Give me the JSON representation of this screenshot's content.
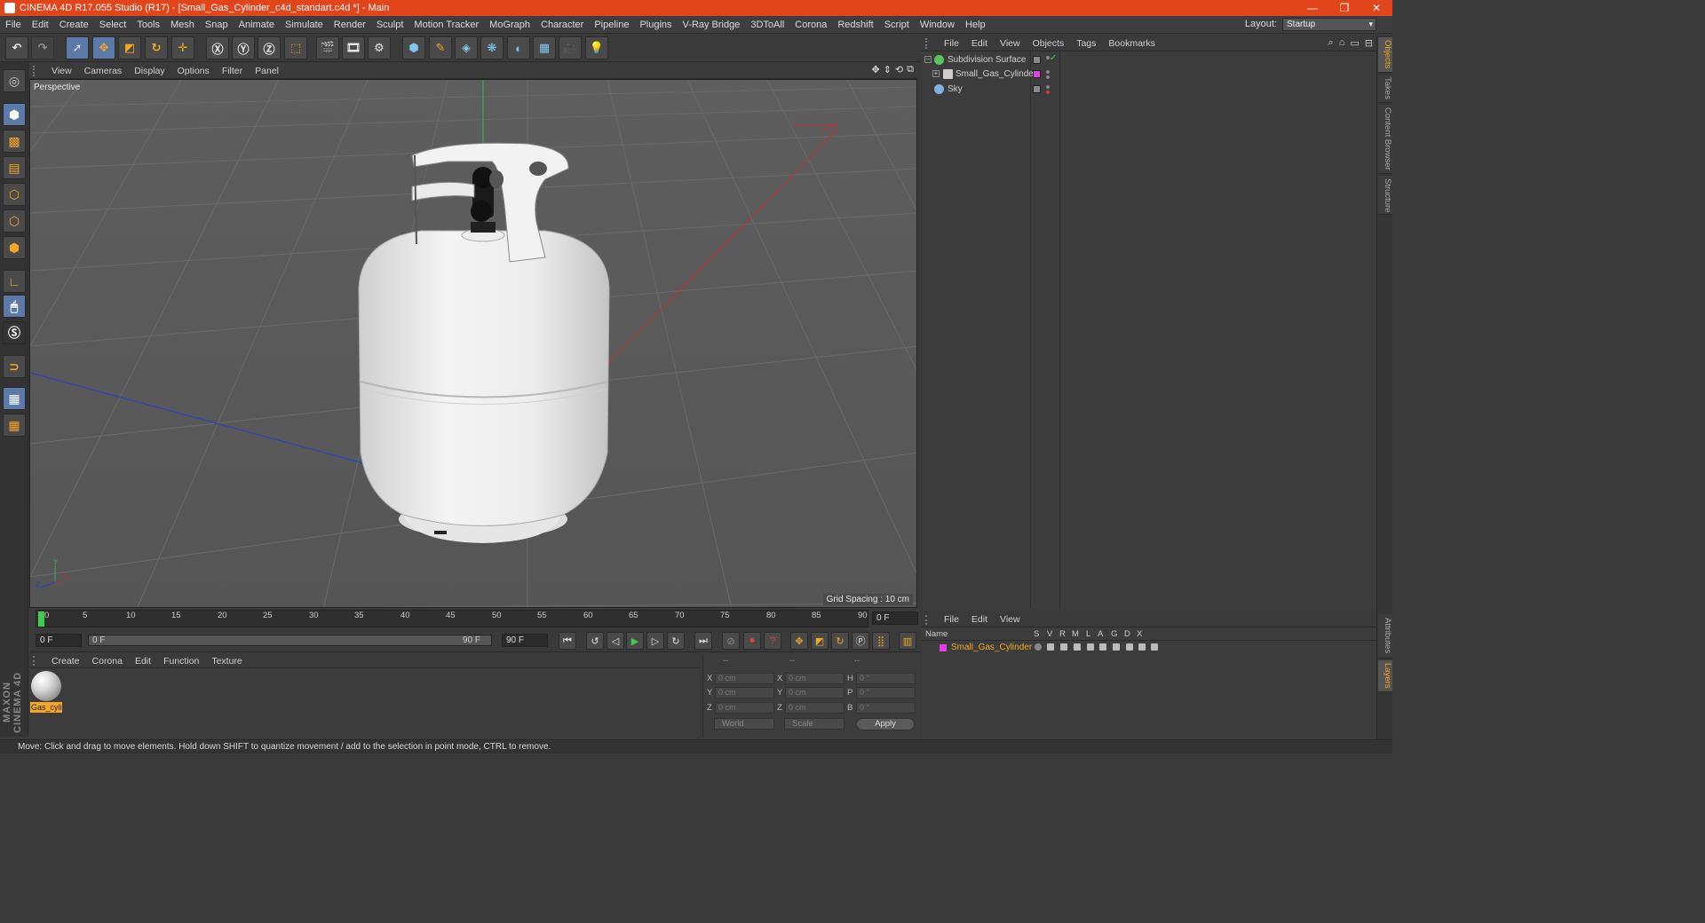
{
  "window": {
    "title": "CINEMA 4D R17.055 Studio (R17) - [Small_Gas_Cylinder_c4d_standart.c4d *] - Main",
    "controls": [
      "—",
      "❐",
      "✕"
    ]
  },
  "menubar": {
    "items": [
      "File",
      "Edit",
      "Create",
      "Select",
      "Tools",
      "Mesh",
      "Snap",
      "Animate",
      "Simulate",
      "Render",
      "Sculpt",
      "Motion Tracker",
      "MoGraph",
      "Character",
      "Pipeline",
      "Plugins",
      "V-Ray Bridge",
      "3DToAll",
      "Corona",
      "Redshift",
      "Script",
      "Window",
      "Help"
    ],
    "layout_label": "Layout:",
    "layout_value": "Startup"
  },
  "viewport": {
    "menus": [
      "View",
      "Cameras",
      "Display",
      "Options",
      "Filter",
      "Panel"
    ],
    "camera_label": "Perspective",
    "grid_spacing": "Grid Spacing : 10 cm"
  },
  "timeline": {
    "ticks": [
      "0",
      "5",
      "10",
      "15",
      "20",
      "25",
      "30",
      "35",
      "40",
      "45",
      "50",
      "55",
      "60",
      "65",
      "70",
      "75",
      "80",
      "85",
      "90"
    ],
    "frame_end_box": "0 F",
    "current_frame": "0 F",
    "range_start": "0 F",
    "range_end": "90 F",
    "max_frame": "90 F"
  },
  "material_manager": {
    "menus": [
      "Create",
      "Corona",
      "Edit",
      "Function",
      "Texture"
    ],
    "materials": [
      {
        "name": "Gas_cyli"
      }
    ]
  },
  "coordinates": {
    "headers": [
      "--",
      "--",
      "--"
    ],
    "rows": [
      {
        "a_label": "X",
        "a_value": "0 cm",
        "b_label": "X",
        "b_value": "0 cm",
        "c_label": "H",
        "c_value": "0 °"
      },
      {
        "a_label": "Y",
        "a_value": "0 cm",
        "b_label": "Y",
        "b_value": "0 cm",
        "c_label": "P",
        "c_value": "0 °"
      },
      {
        "a_label": "Z",
        "a_value": "0 cm",
        "b_label": "Z",
        "b_value": "0 cm",
        "c_label": "B",
        "c_value": "0 °"
      }
    ],
    "space_select": "World",
    "mode_select": "Scale",
    "apply_label": "Apply"
  },
  "object_manager": {
    "menus": [
      "File",
      "Edit",
      "View",
      "Objects",
      "Tags",
      "Bookmarks"
    ],
    "objects": [
      {
        "name": "Subdivision Surface",
        "color": "#5ec35e"
      },
      {
        "name": "Small_Gas_Cylinder",
        "color": "#e040e0"
      },
      {
        "name": "Sky",
        "color": "#7fb0e0"
      }
    ]
  },
  "layer_manager": {
    "menus": [
      "File",
      "Edit",
      "View"
    ],
    "columns": [
      "Name",
      "S",
      "V",
      "R",
      "M",
      "L",
      "A",
      "G",
      "D",
      "X"
    ],
    "rows": [
      {
        "name": "Small_Gas_Cylinder",
        "color": "#e040e0"
      }
    ]
  },
  "right_tabs": {
    "top": [
      "Objects",
      "Takes",
      "Content Browser",
      "Structure"
    ],
    "bottom": [
      "Attributes",
      "Layers"
    ]
  },
  "statusbar": {
    "text": "Move: Click and drag to move elements. Hold down SHIFT to quantize movement / add to the selection in point mode, CTRL to remove."
  },
  "brand": {
    "logo_text": "MAXON CINEMA 4D"
  },
  "colors": {
    "accent": "#f5a623",
    "titlebar": "#e2451c",
    "selection": "#5b7aa8"
  }
}
